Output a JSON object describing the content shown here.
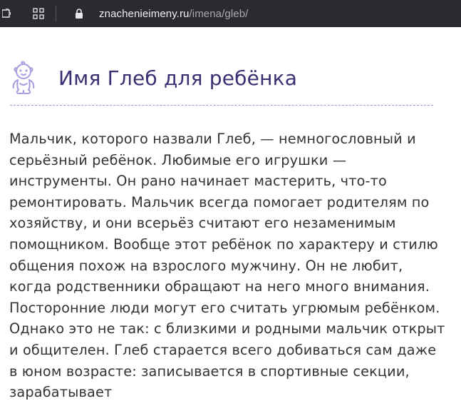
{
  "browser": {
    "url_host": "znachenieimeny.ru",
    "url_path": "/imena/gleb/",
    "icons": [
      "extension-icon",
      "apps-grid-icon",
      "lock-icon"
    ]
  },
  "page": {
    "title": "Имя Глеб для ребёнка",
    "title_icon": "baby-icon",
    "accent_color": "#3a2f73",
    "icon_color": "#a79be0",
    "paragraph": "Мальчик, которого назвали Глеб, — немногословный и серьёзный ребёнок. Любимые его игрушки — инструменты. Он рано начинает мастерить, что-то ремонтировать. Мальчик всегда помогает родителям по хозяйству, и они всерьёз считают его незаменимым помощником. Вообще этот ребёнок по характеру и стилю общения похож на взрослого мужчину. Он не любит, когда родственники обращают на него много внимания. Посторонние люди могут его считать угрюмым ребёнком. Однако это не так: с близкими и родными мальчик открыт и общителен. Глеб старается всего добиваться сам даже в юном возрасте: записывается в спортивные секции, зарабатывает"
  }
}
